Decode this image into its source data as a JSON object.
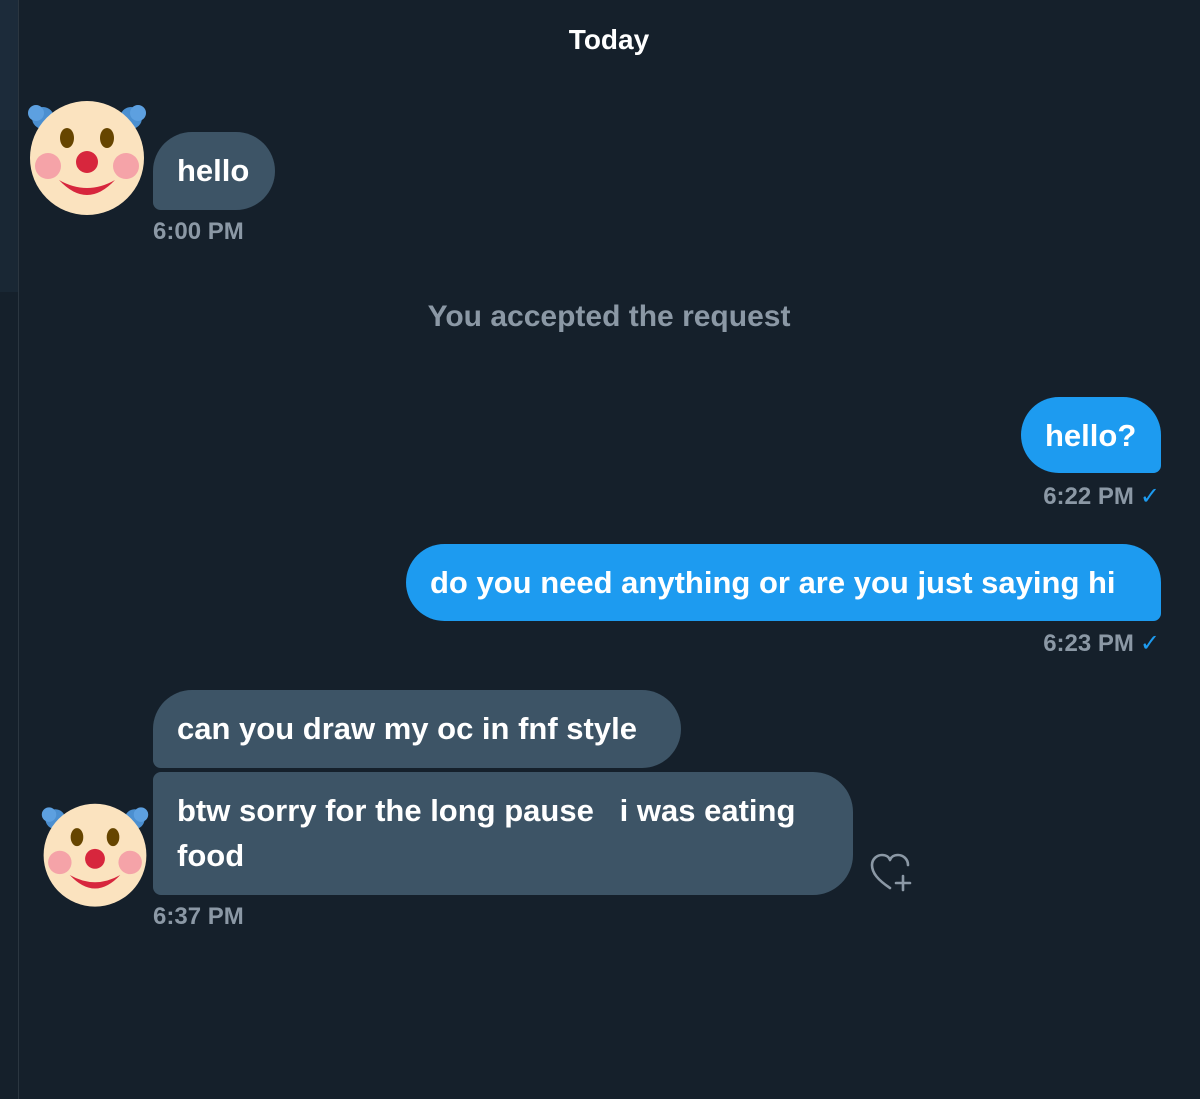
{
  "conversation": {
    "day_label": "Today",
    "system_note": "You accepted the request",
    "messages": [
      {
        "text": "hello",
        "timestamp": "6:00 PM"
      },
      {
        "text": "hello?",
        "timestamp": "6:22 PM",
        "status": "✓"
      },
      {
        "text": "do you need anything or are you just saying hi",
        "timestamp": "6:23 PM",
        "status": "✓"
      },
      {
        "text": "can you draw my oc in fnf style"
      },
      {
        "text_line1": "btw sorry for the long pause   i was eating",
        "text_line2": "food",
        "timestamp": "6:37 PM"
      }
    ]
  },
  "icons": {
    "avatar": "clown-face-icon",
    "reaction": "heart-plus-icon",
    "read_receipt": "checkmark-icon"
  },
  "colors": {
    "background": "#15202b",
    "incoming_bubble": "#3d5466",
    "outgoing_bubble": "#1d9bf0",
    "muted_text": "#8b98a5"
  }
}
